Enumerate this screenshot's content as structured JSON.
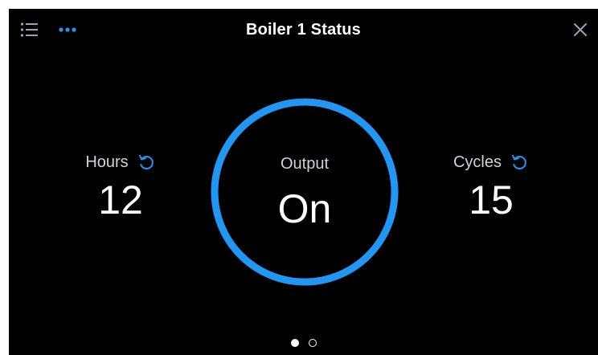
{
  "header": {
    "title": "Boiler 1 Status",
    "menu_icon": "list-icon",
    "more_icon": "more-horizontal-icon",
    "close_icon": "close-icon"
  },
  "stats": {
    "hours": {
      "label": "Hours",
      "value": "12",
      "reset_icon": "reset-icon"
    },
    "output": {
      "label": "Output",
      "value": "On"
    },
    "cycles": {
      "label": "Cycles",
      "value": "15",
      "reset_icon": "reset-icon"
    }
  },
  "pager": {
    "page_count": 2,
    "active_page": 1
  },
  "colors": {
    "background": "#000000",
    "accent": "#2196f3",
    "text": "#ffffff",
    "label": "#cfd3d8"
  }
}
